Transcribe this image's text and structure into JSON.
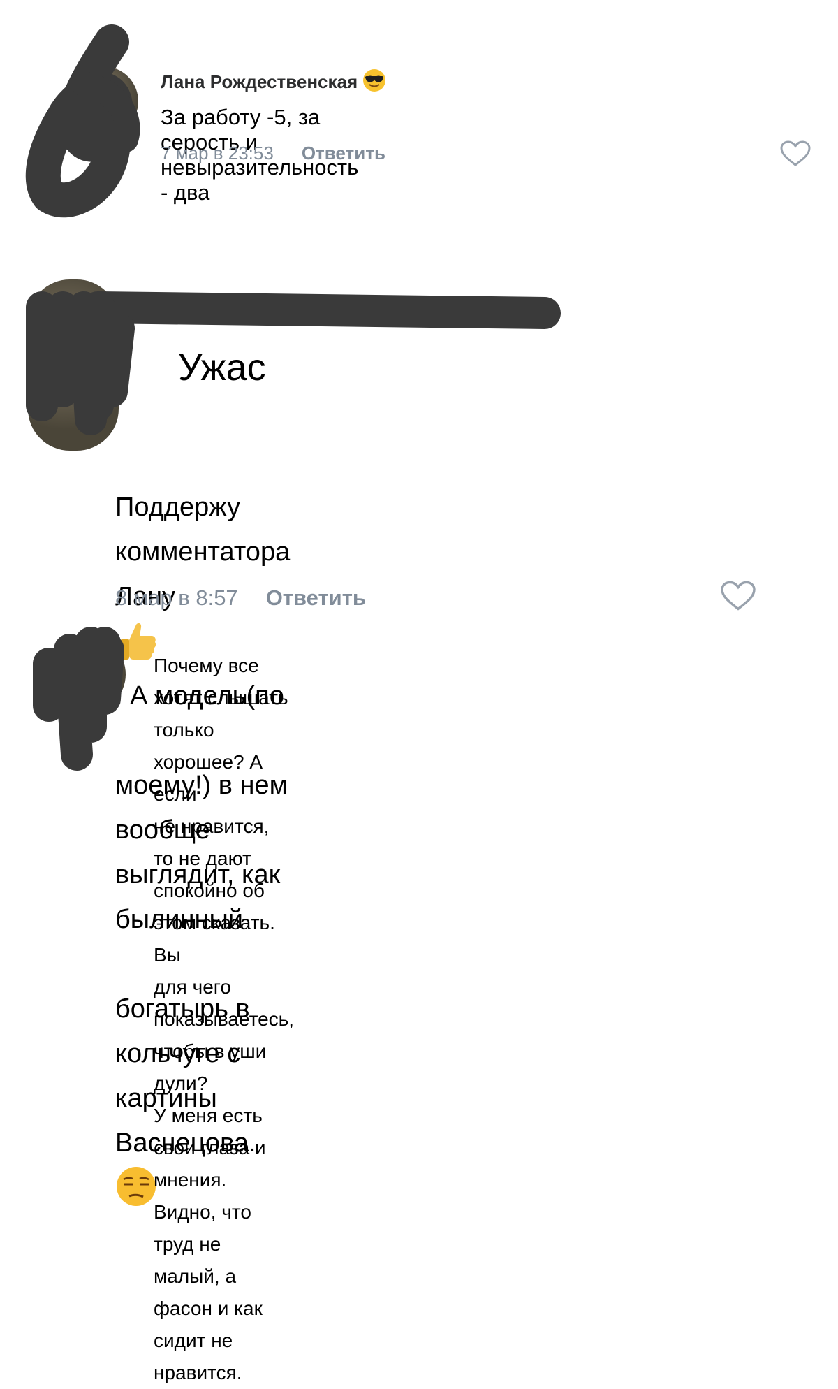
{
  "comments": [
    {
      "author": "Лана Рождественская",
      "text": "За работу -5, за серость и невыразительность - два",
      "date": "7 мар в 23:53",
      "reply_label": "Ответить",
      "emoji": "sunglasses-face"
    },
    {
      "author": "",
      "text": "Ужас",
      "date": "",
      "reply_label": ""
    },
    {
      "author": "",
      "text_parts": [
        "Поддержу комментатора Лану",
        ". А модель(по",
        "моему!) в нем вообще выглядит, как былинный",
        "богатырь в кольчуге с картины Васнецова."
      ],
      "date": "8 мар в 8:57",
      "reply_label": "Ответить",
      "emojis": [
        "thumbs-up",
        "unamused-face"
      ]
    },
    {
      "author": "",
      "text": "Почему все хотят слышать только хорошее? А если\nне нравится, то не дают спокойно об этом сказать. Вы\nдля чего показываетесь, чтобы в уши дули?\nУ меня есть свои глаза и мнения. Видно, что труд не\nмалый, а фасон и как сидит не нравится."
    }
  ],
  "colors": {
    "meta": "#818c99",
    "scribble": "#3a3a3a",
    "heart": "#99a2ad"
  }
}
